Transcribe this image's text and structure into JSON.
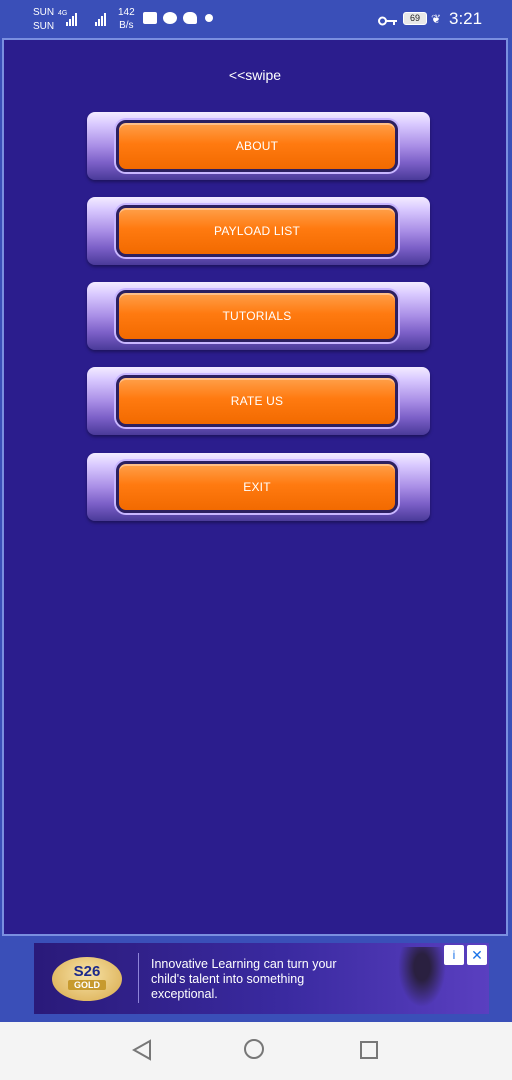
{
  "status_bar": {
    "carrier_1": "SUN",
    "carrier_2": "SUN",
    "network": "4G",
    "speed_value": "142",
    "speed_unit": "B/s",
    "battery": "69",
    "time": "3:21"
  },
  "app": {
    "swipe_hint": "<<swipe",
    "menu": [
      {
        "label": "ABOUT"
      },
      {
        "label": "PAYLOAD LIST"
      },
      {
        "label": "TUTORIALS"
      },
      {
        "label": "RATE US"
      },
      {
        "label": "EXIT"
      }
    ]
  },
  "ad": {
    "logo_text": "S26",
    "logo_sub": "GOLD",
    "headline": "Innovative Learning can turn your child's talent into something exceptional.",
    "info_icon": "i",
    "close_icon": "✕"
  },
  "colors": {
    "panel_bg": "#2b1d8d",
    "button_orange": "#ff7a10",
    "status_bg": "#3a4fb8"
  }
}
